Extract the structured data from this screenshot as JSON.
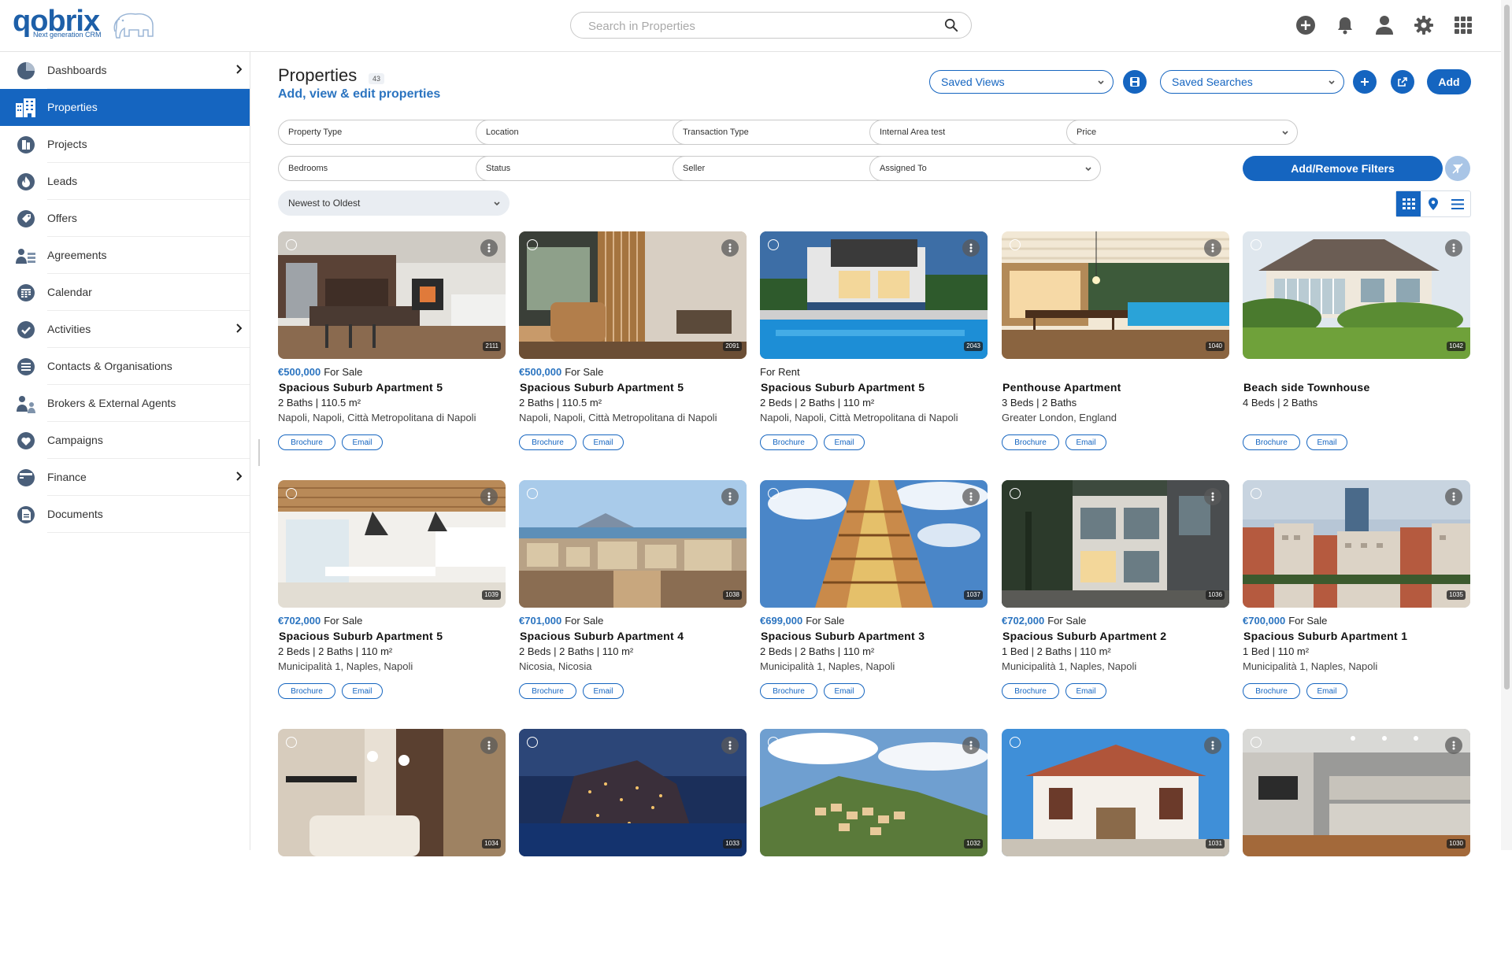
{
  "app": {
    "logo_word": "qobrix",
    "logo_tagline": "Next generation CRM"
  },
  "search": {
    "placeholder": "Search in Properties"
  },
  "sidebar": {
    "items": [
      {
        "label": "Dashboards",
        "icon": "pie-chart-icon",
        "chevron": true
      },
      {
        "label": "Properties",
        "icon": "building-icon",
        "active": true
      },
      {
        "label": "Projects",
        "icon": "projects-icon"
      },
      {
        "label": "Leads",
        "icon": "flame-icon"
      },
      {
        "label": "Offers",
        "icon": "tag-icon"
      },
      {
        "label": "Agreements",
        "icon": "agreements-icon"
      },
      {
        "label": "Calendar",
        "icon": "calendar-icon"
      },
      {
        "label": "Activities",
        "icon": "check-circle-icon",
        "chevron": true
      },
      {
        "label": "Contacts & Organisations",
        "icon": "contacts-icon"
      },
      {
        "label": "Brokers & External Agents",
        "icon": "brokers-icon"
      },
      {
        "label": "Campaigns",
        "icon": "heart-icon"
      },
      {
        "label": "Finance",
        "icon": "finance-icon",
        "chevron": true
      },
      {
        "label": "Documents",
        "icon": "documents-icon"
      }
    ]
  },
  "header": {
    "title": "Properties",
    "count": "43",
    "subtitle": "Add, view & edit properties",
    "saved_views": "Saved Views",
    "saved_searches": "Saved Searches",
    "add_label": "Add"
  },
  "filters": {
    "row1": [
      "Property Type",
      "Location",
      "Transaction Type",
      "Internal Area test",
      "Price"
    ],
    "row2": [
      "Bedrooms",
      "Status",
      "Seller",
      "Assigned To"
    ],
    "add_remove_label": "Add/Remove Filters",
    "sort": "Newest to Oldest"
  },
  "cards": [
    {
      "price": "€500,000",
      "status": "For Sale",
      "title": "Spacious Suburb Apartment 5",
      "specs": "2 Baths | 110.5 m²",
      "location": "Napoli, Napoli, Città Metropolitana di Napoli",
      "id": "2111",
      "scene": "kitchen"
    },
    {
      "price": "€500,000",
      "status": "For Sale",
      "title": "Spacious Suburb Apartment 5",
      "specs": "2 Baths | 110.5 m²",
      "location": "Napoli, Napoli, Città Metropolitana di Napoli",
      "id": "2091",
      "scene": "lounge"
    },
    {
      "price": "",
      "status": "For Rent",
      "title": "Spacious Suburb Apartment 5",
      "specs": "2 Beds | 2 Baths | 110 m²",
      "location": "Napoli, Napoli, Città Metropolitana di Napoli",
      "id": "2043",
      "scene": "pool-house"
    },
    {
      "price": "",
      "status": "",
      "title": "Penthouse Apartment",
      "specs": "3 Beds | 2 Baths",
      "location": "Greater London, England",
      "id": "1040",
      "scene": "terrace"
    },
    {
      "price": "",
      "status": "",
      "title": "Beach side Townhouse",
      "specs": "4 Beds | 2 Baths",
      "location": "",
      "id": "1042",
      "scene": "villa"
    },
    {
      "price": "€702,000",
      "status": "For Sale",
      "title": "Spacious Suburb Apartment 5",
      "specs": "2 Beds | 2 Baths | 110 m²",
      "location": "Municipalità 1, Naples, Napoli",
      "id": "1039",
      "scene": "white-kitchen"
    },
    {
      "price": "€701,000",
      "status": "For Sale",
      "title": "Spacious Suburb Apartment 4",
      "specs": "2 Beds | 2 Baths | 110 m²",
      "location": "Nicosia, Nicosia",
      "id": "1038",
      "scene": "city-bay"
    },
    {
      "price": "€699,000",
      "status": "For Sale",
      "title": "Spacious Suburb Apartment 3",
      "specs": "2 Beds | 2 Baths | 110 m²",
      "location": "Municipalità 1, Naples, Napoli",
      "id": "1037",
      "scene": "tower"
    },
    {
      "price": "€702,000",
      "status": "For Sale",
      "title": "Spacious Suburb Apartment 2",
      "specs": "1 Bed | 2 Baths | 110 m²",
      "location": "Municipalità 1, Naples, Napoli",
      "id": "1036",
      "scene": "modern-building"
    },
    {
      "price": "€700,000",
      "status": "For Sale",
      "title": "Spacious Suburb Apartment 1",
      "specs": "1 Bed | 110 m²",
      "location": "Municipalità 1, Naples, Napoli",
      "id": "1035",
      "scene": "city"
    },
    {
      "price": "",
      "status": "",
      "title": "",
      "specs": "",
      "location": "",
      "id": "1034",
      "scene": "living"
    },
    {
      "price": "",
      "status": "",
      "title": "",
      "specs": "",
      "location": "",
      "id": "1033",
      "scene": "night-coast"
    },
    {
      "price": "",
      "status": "",
      "title": "",
      "specs": "",
      "location": "",
      "id": "1032",
      "scene": "hill-town"
    },
    {
      "price": "",
      "status": "",
      "title": "",
      "specs": "",
      "location": "",
      "id": "1031",
      "scene": "white-house"
    },
    {
      "price": "",
      "status": "",
      "title": "",
      "specs": "",
      "location": "",
      "id": "1030",
      "scene": "grey-kitchen"
    }
  ],
  "card_actions": {
    "brochure": "Brochure",
    "email": "Email"
  },
  "colors": {
    "accent": "#1565c0",
    "price": "#2b74c0",
    "active_nav": "#1565c0"
  }
}
